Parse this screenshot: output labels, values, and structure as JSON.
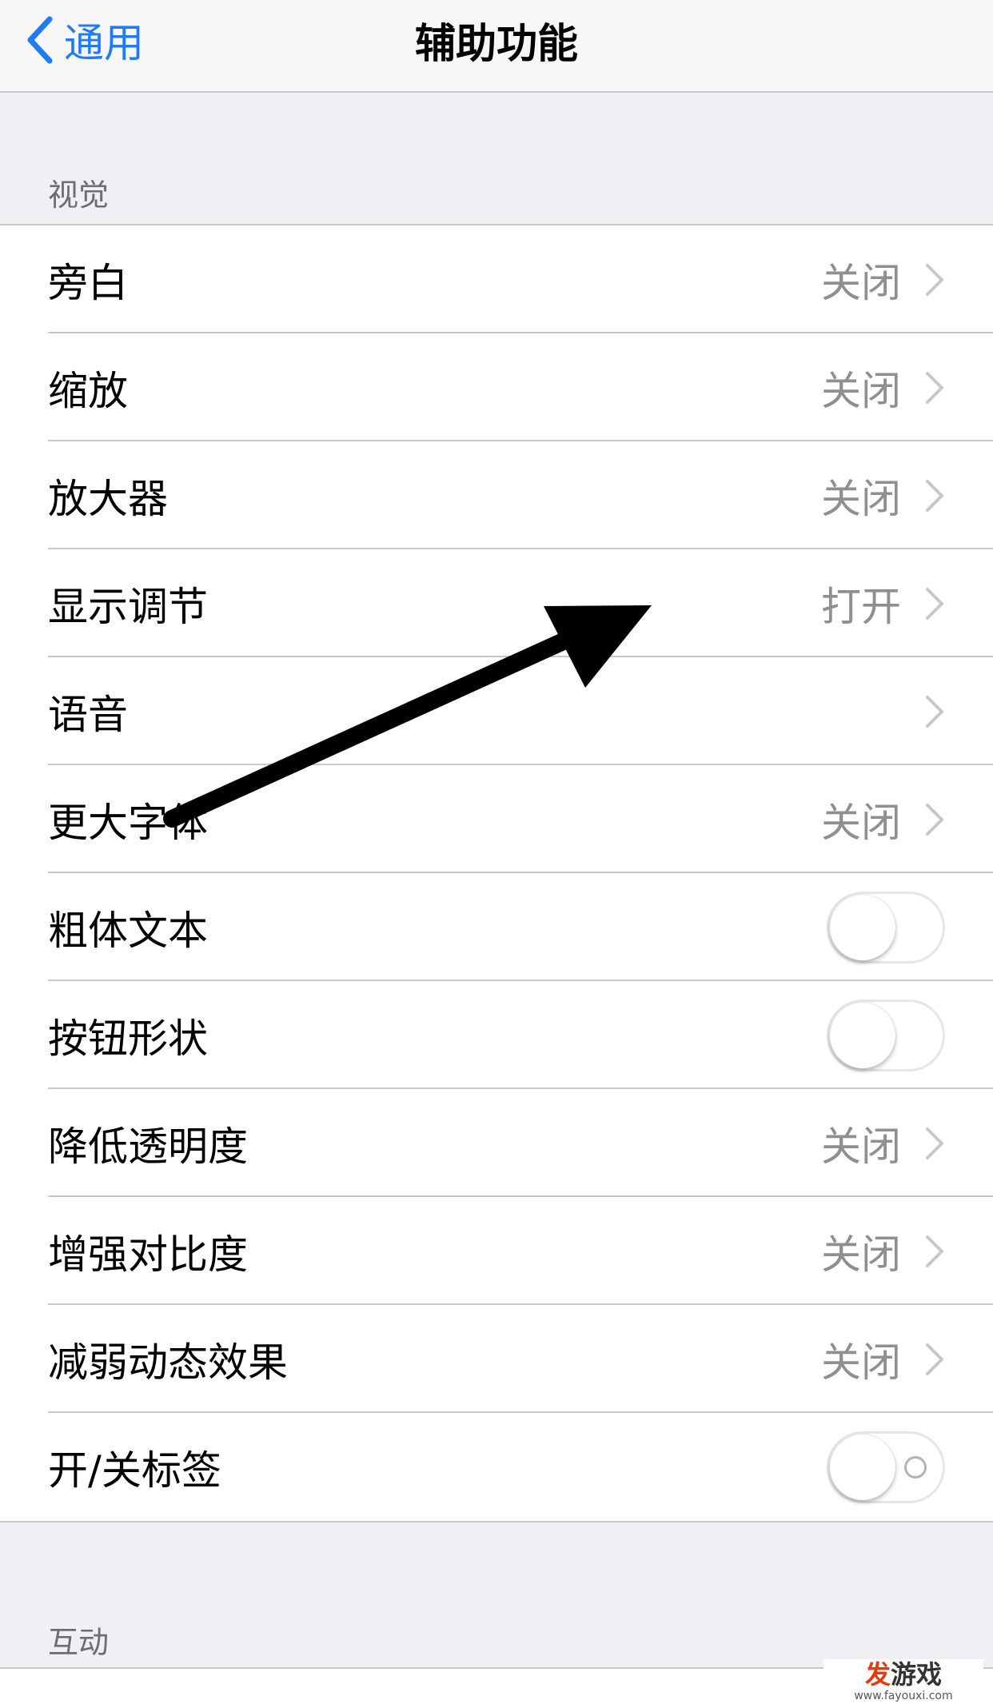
{
  "nav": {
    "back_label": "通用",
    "title": "辅助功能"
  },
  "sections": [
    {
      "header": "视觉",
      "rows": [
        {
          "label": "旁白",
          "value": "关闭",
          "type": "disclosure"
        },
        {
          "label": "缩放",
          "value": "关闭",
          "type": "disclosure"
        },
        {
          "label": "放大器",
          "value": "关闭",
          "type": "disclosure"
        },
        {
          "label": "显示调节",
          "value": "打开",
          "type": "disclosure"
        },
        {
          "label": "语音",
          "value": "",
          "type": "disclosure"
        },
        {
          "label": "更大字体",
          "value": "关闭",
          "type": "disclosure"
        },
        {
          "label": "粗体文本",
          "value": "",
          "type": "toggle",
          "on": false
        },
        {
          "label": "按钮形状",
          "value": "",
          "type": "toggle",
          "on": false
        },
        {
          "label": "降低透明度",
          "value": "关闭",
          "type": "disclosure"
        },
        {
          "label": "增强对比度",
          "value": "关闭",
          "type": "disclosure"
        },
        {
          "label": "减弱动态效果",
          "value": "关闭",
          "type": "disclosure"
        },
        {
          "label": "开/关标签",
          "value": "",
          "type": "toggle",
          "on": false
        }
      ]
    },
    {
      "header": "互动"
    }
  ],
  "watermark": {
    "main_a": "发",
    "main_b": "游戏",
    "sub": "www.fayouxi.com"
  },
  "colors": {
    "accent": "#1e7cf6",
    "secondary_text": "#8e8e93",
    "background": "#efeff4",
    "separator": "#c8c7cc"
  }
}
